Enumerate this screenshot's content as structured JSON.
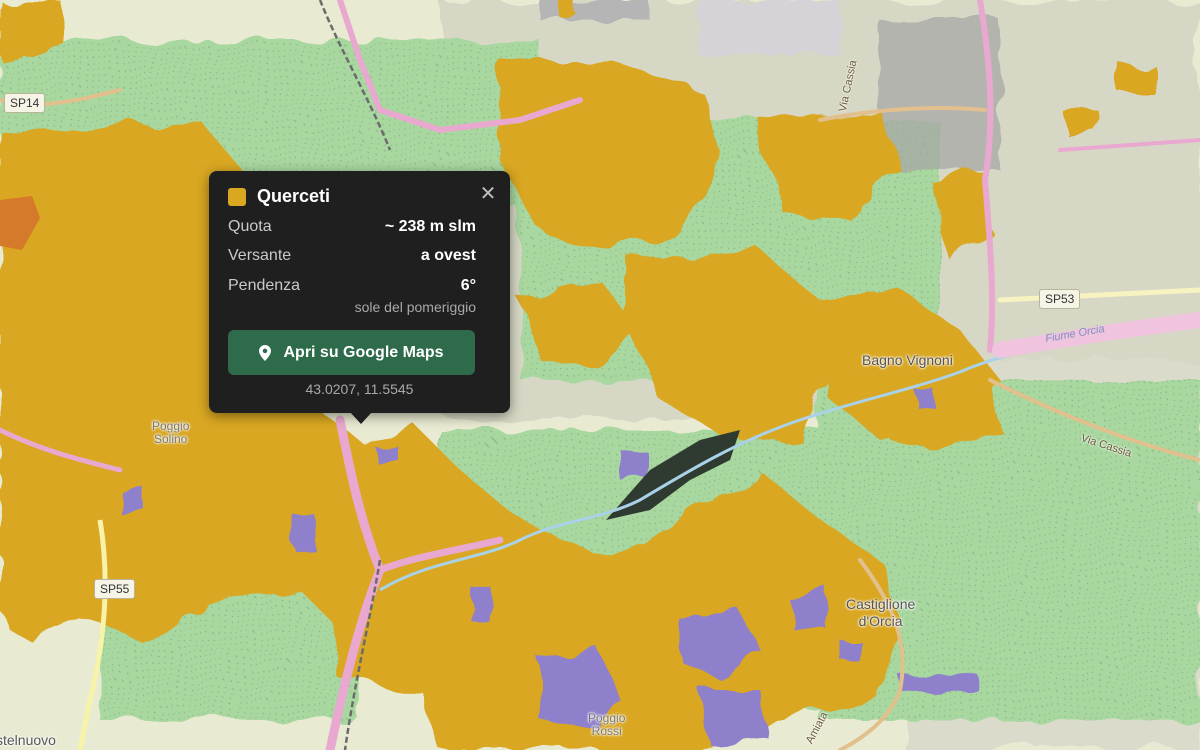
{
  "colors": {
    "oak_woodland": "#d9a720",
    "other_woodland": "#8f80cc",
    "orange_patch": "#d5792a",
    "popup_bg": "#1f1f1f",
    "button_green": "#2e6b4b"
  },
  "map": {
    "places": [
      {
        "name": "Bagno Vignoni"
      },
      {
        "name": "Castiglione\nd'Orcia"
      },
      {
        "name": "Poggio\nSolino"
      },
      {
        "name": "Poggio\nRossi"
      },
      {
        "name": "stelnuovo"
      }
    ],
    "road_shields": [
      "SP14",
      "SP53",
      "SP55"
    ],
    "road_names": [
      "Via Cassia",
      "Via Cassia",
      "Amiata"
    ],
    "river_name": "Fiume Orcia"
  },
  "popup": {
    "title": "Querceti",
    "swatch_color": "#d9a720",
    "close_icon": "close-icon",
    "rows": [
      {
        "label": "Quota",
        "value": "~ 238 m slm"
      },
      {
        "label": "Versante",
        "value": "a ovest"
      },
      {
        "label": "Pendenza",
        "value": "6°"
      }
    ],
    "note": "sole del pomeriggio",
    "button_label": "Apri su Google Maps",
    "button_icon": "map-pin-icon",
    "coordinates": "43.0207, 11.5545"
  }
}
